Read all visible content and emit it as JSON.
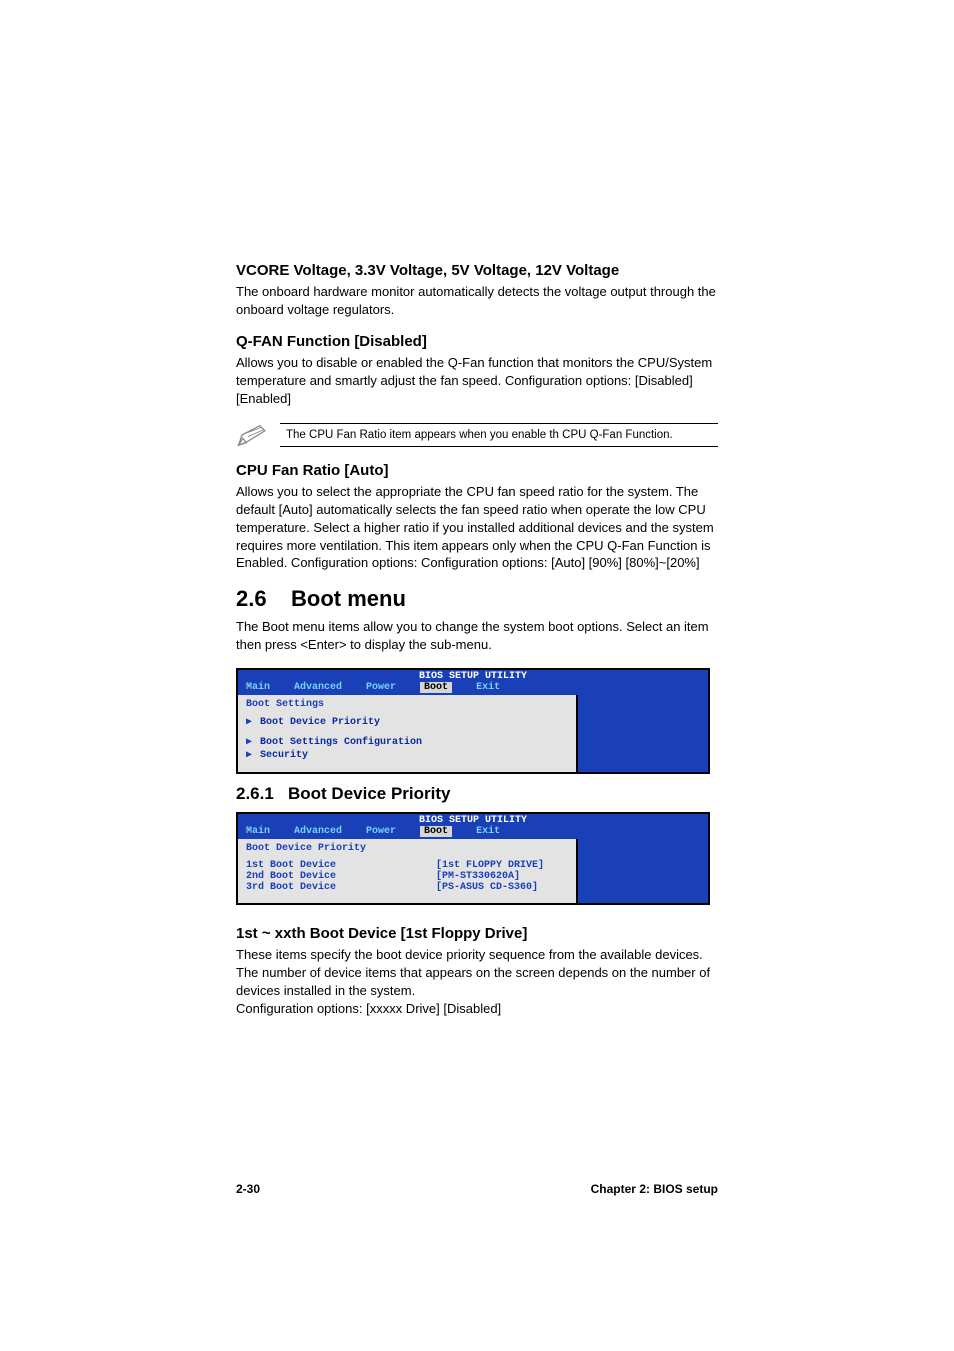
{
  "sec1": {
    "heading": "VCORE Voltage, 3.3V Voltage, 5V Voltage, 12V Voltage",
    "body": "The onboard hardware monitor automatically detects the voltage output through the onboard voltage regulators."
  },
  "sec2": {
    "heading": "Q-FAN Function [Disabled]",
    "body": "Allows you to disable or enabled the Q-Fan function that monitors the CPU/System temperature and smartly adjust the fan speed. Configuration options: [Disabled] [Enabled]"
  },
  "note": {
    "text": "The CPU Fan Ratio item appears when you enable th CPU Q-Fan Function."
  },
  "sec3": {
    "heading": "CPU Fan Ratio [Auto]",
    "body": "Allows you to select the appropriate the CPU fan speed ratio for the system. The default [Auto] automatically selects the fan speed ratio when operate the  low CPU temperature. Select a higher ratio if you installed additional devices and the system requires more ventilation. This item appears only when the CPU Q-Fan Function is Enabled. Configuration options: Configuration options: [Auto] [90%] [80%]~[20%]"
  },
  "boot": {
    "heading_num": "2.6",
    "heading_text": "Boot menu",
    "body": "The Boot menu items allow you to change the system boot options. Select an item then press <Enter> to display the sub-menu."
  },
  "bios1": {
    "title": "BIOS SETUP UTILITY",
    "tabs": {
      "main": "Main",
      "advanced": "Advanced",
      "power": "Power",
      "boot": "Boot",
      "exit": "Exit"
    },
    "panel_title": "Boot Settings",
    "items": {
      "a": "Boot Device Priority",
      "b": "Boot Settings Configuration",
      "c": "Security"
    }
  },
  "bdp": {
    "heading_num": "2.6.1",
    "heading_text": "Boot Device Priority"
  },
  "bios2": {
    "title": "BIOS SETUP UTILITY",
    "tabs": {
      "main": "Main",
      "advanced": "Advanced",
      "power": "Power",
      "boot": "Boot",
      "exit": "Exit"
    },
    "panel_title": "Boot Device Priority",
    "rows": [
      {
        "k": "1st Boot Device",
        "v": "[1st FLOPPY DRIVE]"
      },
      {
        "k": "2nd Boot Device",
        "v": "[PM-ST330620A]"
      },
      {
        "k": "3rd Boot Device",
        "v": "[PS-ASUS CD-S360]"
      }
    ]
  },
  "sec4": {
    "heading": "1st ~ xxth Boot Device [1st Floppy Drive]",
    "body": "These items specify the boot device priority sequence from the available devices. The number of device items that appears on the screen depends on the number of devices installed in the system.",
    "body2": "Configuration options: [xxxxx Drive] [Disabled]"
  },
  "footer": {
    "left": "2-30",
    "right": "Chapter 2: BIOS setup"
  }
}
